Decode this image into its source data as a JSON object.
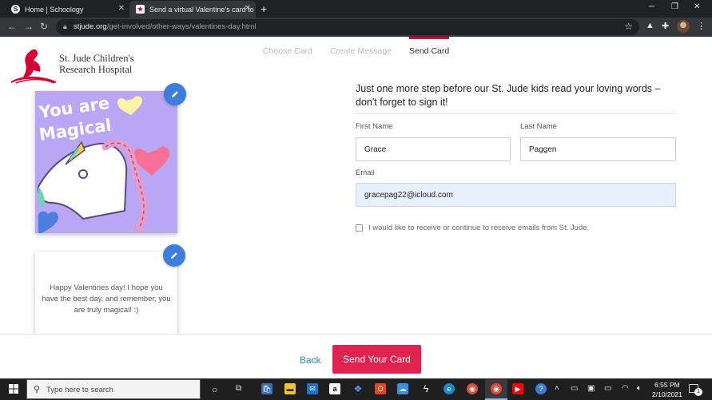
{
  "browser": {
    "tabs": [
      {
        "title": "Home | Schoology",
        "favicon": "S"
      },
      {
        "title": "Send a virtual Valentine's card to",
        "favicon": "★"
      }
    ],
    "url_domain": "stjude.org",
    "url_path": "/get-involved/other-ways/valentines-day.html"
  },
  "logo": {
    "line1": "St. Jude Children's",
    "line2": "Research Hospital",
    "color": "#d50032"
  },
  "steps": {
    "choose": "Choose Card",
    "create": "Create Message",
    "send": "Send Card",
    "active": "send"
  },
  "card": {
    "image_text_line1": "You are",
    "image_text_line2": "Magical",
    "message": "Happy Valentines day! I hope you have the best day, and remember, you are truly magical! :)"
  },
  "form": {
    "headline": "Just one more step before our St. Jude kids read your loving words – don't forget to sign it!",
    "first_name_label": "First Name",
    "first_name_value": "Grace",
    "last_name_label": "Last Name",
    "last_name_value": "Paggen",
    "email_label": "Email",
    "email_value": "gracepag22@icloud.com",
    "optin_label": "I would like to receive or continue to receive emails from St. Jude.",
    "optin_checked": false
  },
  "footer": {
    "back_label": "Back",
    "send_label": "Send Your Card",
    "accent": "#e0224f",
    "link_color": "#3d7ddb"
  },
  "taskbar": {
    "search_placeholder": "Type here to search",
    "time": "6:55 PM",
    "date": "2/10/2021",
    "notification_count": "1"
  }
}
